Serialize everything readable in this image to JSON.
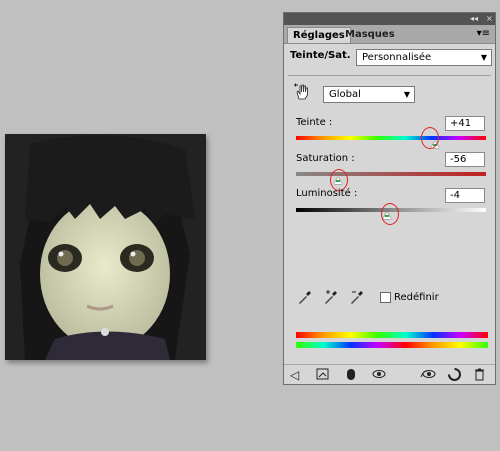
{
  "tabs": [
    {
      "label": "Réglages"
    },
    {
      "label": "Masques"
    }
  ],
  "adjustment": {
    "title": "Teinte/Sat.",
    "preset": "Personnalisée",
    "range": "Global"
  },
  "sliders": {
    "hue": {
      "label": "Teinte :",
      "value": "+41",
      "fraction": 0.73
    },
    "saturation": {
      "label": "Saturation :",
      "value": "-56",
      "fraction": 0.22
    },
    "lightness": {
      "label": "Luminosité :",
      "value": "-4",
      "fraction": 0.48
    }
  },
  "colorize": {
    "label": "Redéfinir",
    "checked": false
  },
  "icons": {
    "panel_menu": "panel-menu-icon",
    "collapse": "collapse-icon",
    "targeted_adjust": "hand-adjust-icon",
    "eyedroppers": [
      "eyedropper-icon",
      "eyedropper-plus-icon",
      "eyedropper-minus-icon"
    ],
    "toolbar": [
      "back-arrow-icon",
      "clip-layer-icon",
      "mask-icon",
      "visibility-eye-icon",
      "view-previous-icon",
      "reset-icon",
      "delete-icon"
    ]
  },
  "colors": {
    "highlight_circle": "#d22222",
    "thumb_indicator": "#2fa84d"
  }
}
